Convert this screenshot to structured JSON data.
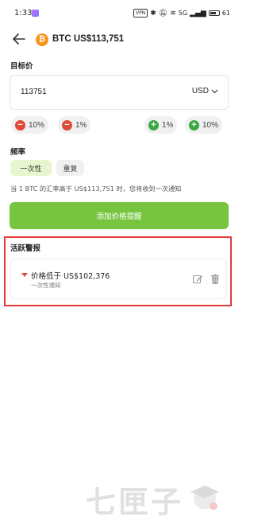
{
  "status_bar": {
    "time": "1:33",
    "vpn": "VPN",
    "network": "5G",
    "battery": "61"
  },
  "header": {
    "coin_symbol": "₿",
    "title": "BTC US$113,751"
  },
  "target_price": {
    "label": "目标价",
    "value": "113751",
    "currency": "USD"
  },
  "percent_buttons": [
    {
      "label": "10%",
      "sign": "−",
      "direction": "decrease"
    },
    {
      "label": "1%",
      "sign": "−",
      "direction": "decrease"
    },
    {
      "label": "1%",
      "sign": "+",
      "direction": "increase"
    },
    {
      "label": "10%",
      "sign": "+",
      "direction": "increase"
    }
  ],
  "frequency": {
    "label": "频率",
    "options": [
      "一次性",
      "重复"
    ],
    "selected": "一次性"
  },
  "info_text": "当 1 BTC 的汇率高于 US$113,751 时，您将收到一次通知",
  "add_button": "添加价格提醒",
  "active_alerts": {
    "label": "活跃警报",
    "items": [
      {
        "title": "价格低于 US$102,376",
        "subtitle": "一次性通知",
        "direction": "below"
      }
    ]
  },
  "watermark": "七匣子",
  "colors": {
    "accent_green": "#77c53e",
    "decrease_red": "#e04a3a",
    "increase_green": "#3ba843",
    "highlight_frame": "#e43a3a",
    "btc_orange": "#f7931a"
  }
}
